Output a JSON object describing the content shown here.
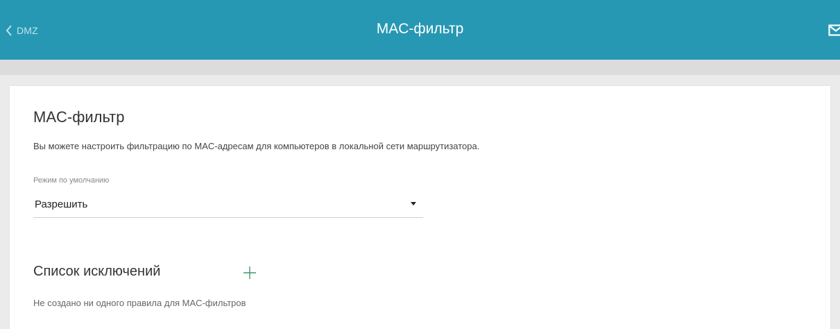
{
  "header": {
    "back_label": "DMZ",
    "title": "MAC-фильтр",
    "icons": {
      "back": "chevron-left-icon",
      "mail": "mail-icon"
    },
    "colors": {
      "bar": "#2798b3",
      "text": "#ffffff"
    }
  },
  "mac_filter": {
    "section_title": "MAC-фильтр",
    "description": "Вы можете настроить фильтрацию по MAC-адресам для компьютеров в локальной сети маршрутизатора.",
    "default_mode": {
      "label": "Режим по умолчанию",
      "value": "Разрешить"
    }
  },
  "exceptions": {
    "title": "Список исключений",
    "add_icon": "plus-icon",
    "empty_message": "Не создано ни одного правила для MAC-фильтров"
  }
}
